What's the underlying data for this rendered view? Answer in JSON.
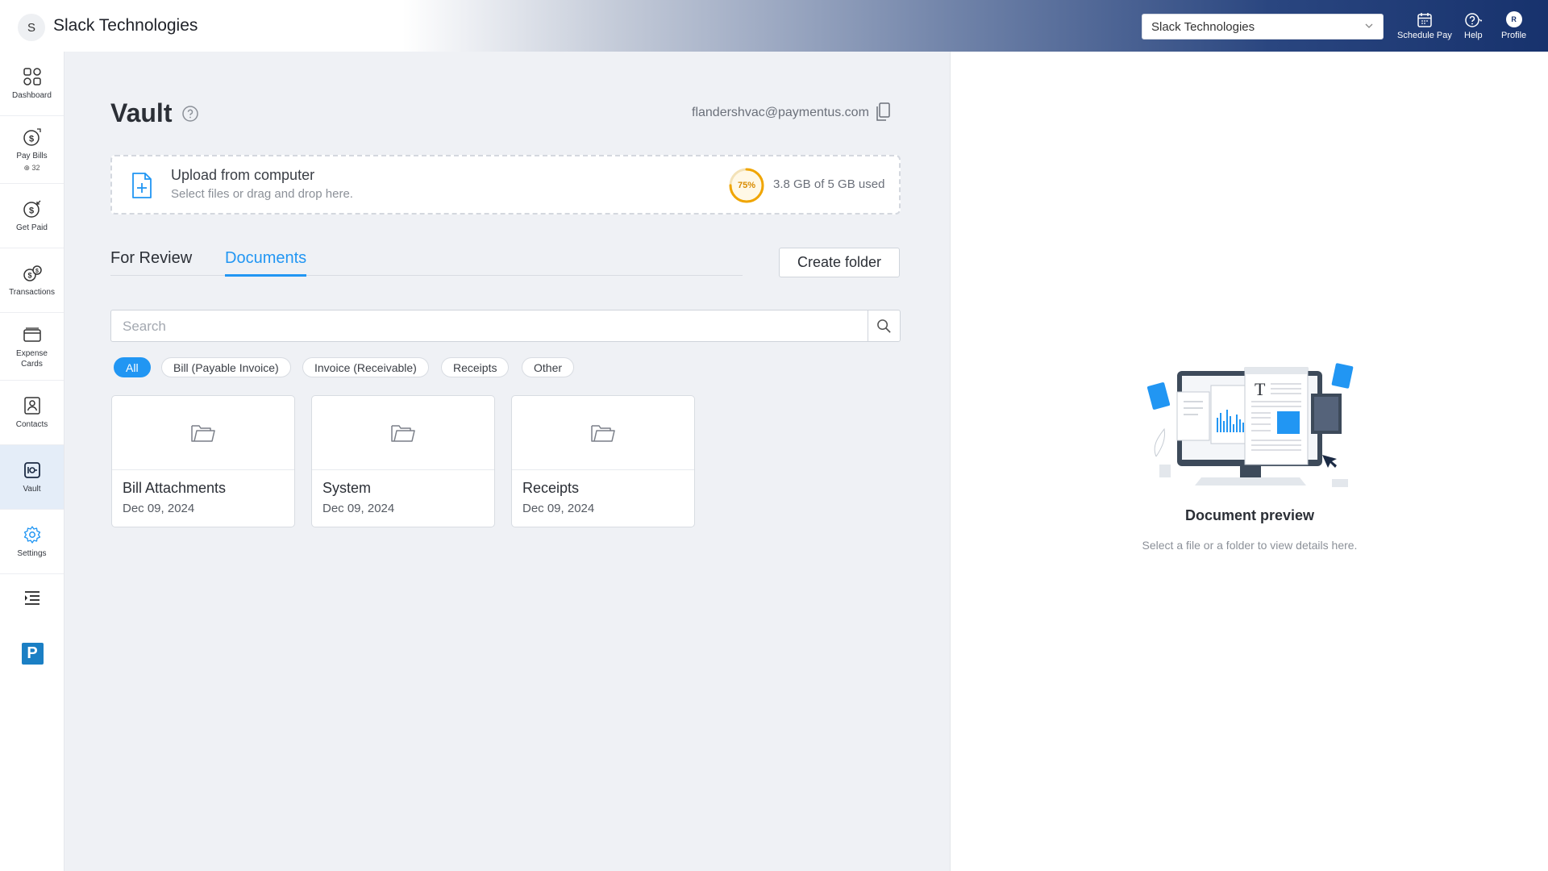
{
  "topbar": {
    "avatar_letter": "S",
    "company_name": "Slack Technologies",
    "company_select_value": "Slack Technologies",
    "actions": [
      {
        "label": "Schedule Pay",
        "icon": "calendar-icon"
      },
      {
        "label": "Help",
        "icon": "help-icon"
      },
      {
        "label": "Profile",
        "icon": "profile-avatar",
        "initial": "R"
      }
    ]
  },
  "sidebar": {
    "items": [
      {
        "label": "Dashboard",
        "icon": "dashboard-icon"
      },
      {
        "label": "Pay Bills",
        "icon": "pay-bills-icon",
        "badge": "⊕ 32"
      },
      {
        "label": "Get Paid",
        "icon": "get-paid-icon"
      },
      {
        "label": "Transactions",
        "icon": "transactions-icon"
      },
      {
        "label": "Expense Cards",
        "icon": "expense-cards-icon"
      },
      {
        "label": "Contacts",
        "icon": "contacts-icon"
      },
      {
        "label": "Vault",
        "icon": "vault-icon",
        "active": true
      },
      {
        "label": "Settings",
        "icon": "settings-icon"
      }
    ],
    "logo_letter": "P"
  },
  "main": {
    "title": "Vault",
    "email": "flandershvac@paymentus.com",
    "upload": {
      "title": "Upload from computer",
      "subtitle": "Select files or drag and drop here.",
      "usage_percent_label": "75%",
      "usage_fraction": 0.75,
      "usage_text": "3.8 GB of 5 GB used"
    },
    "tabs": [
      {
        "label": "For Review",
        "active": false
      },
      {
        "label": "Documents",
        "active": true
      }
    ],
    "create_folder_label": "Create folder",
    "search": {
      "placeholder": "Search"
    },
    "filters": [
      {
        "label": "All",
        "active": true
      },
      {
        "label": "Bill (Payable Invoice)",
        "active": false
      },
      {
        "label": "Invoice (Receivable)",
        "active": false
      },
      {
        "label": "Receipts",
        "active": false
      },
      {
        "label": "Other",
        "active": false
      }
    ],
    "folders": [
      {
        "name": "Bill Attachments",
        "date": "Dec 09, 2024"
      },
      {
        "name": "System",
        "date": "Dec 09, 2024"
      },
      {
        "name": "Receipts",
        "date": "Dec 09, 2024"
      }
    ]
  },
  "preview": {
    "title": "Document preview",
    "subtitle": "Select a file or a folder to view details here."
  },
  "colors": {
    "accent": "#2196f3",
    "usage_ring": "#f0a500",
    "topbar_dark": "#17326d"
  }
}
